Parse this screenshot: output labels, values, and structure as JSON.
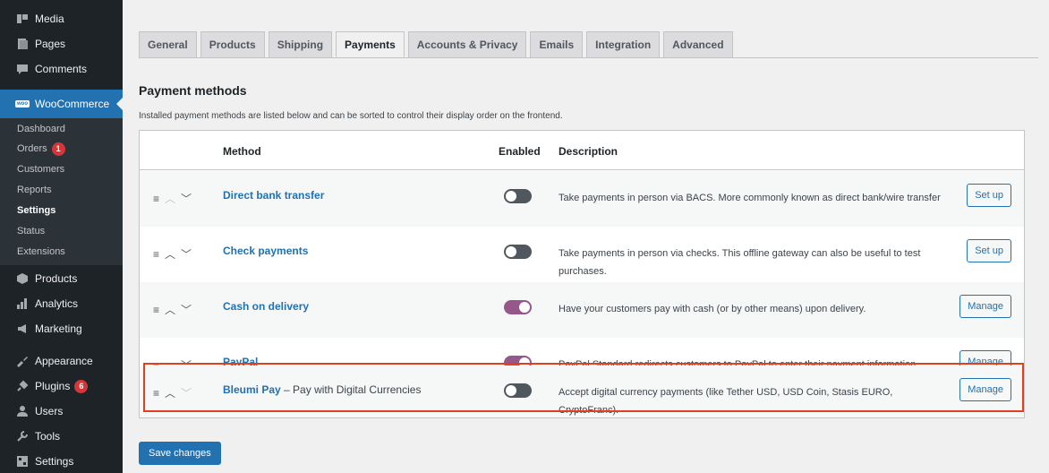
{
  "sidebar": {
    "top_items": [
      {
        "label": "Media",
        "icon": "media-icon"
      },
      {
        "label": "Pages",
        "icon": "pages-icon"
      },
      {
        "label": "Comments",
        "icon": "comments-icon"
      }
    ],
    "woocommerce": {
      "label": "WooCommerce",
      "icon": "woo-icon",
      "icon_text": "woo"
    },
    "submenu": [
      {
        "label": "Dashboard"
      },
      {
        "label": "Orders",
        "badge": "1"
      },
      {
        "label": "Customers"
      },
      {
        "label": "Reports"
      },
      {
        "label": "Settings",
        "current": true
      },
      {
        "label": "Status"
      },
      {
        "label": "Extensions"
      }
    ],
    "bottom_items": [
      {
        "label": "Products",
        "icon": "products-icon"
      },
      {
        "label": "Analytics",
        "icon": "analytics-icon"
      },
      {
        "label": "Marketing",
        "icon": "marketing-icon"
      },
      {
        "label": "Appearance",
        "icon": "appearance-icon"
      },
      {
        "label": "Plugins",
        "icon": "plugins-icon",
        "badge": "6"
      },
      {
        "label": "Users",
        "icon": "users-icon"
      },
      {
        "label": "Tools",
        "icon": "tools-icon"
      },
      {
        "label": "Settings",
        "icon": "settings-icon"
      }
    ]
  },
  "tabs": [
    {
      "label": "General"
    },
    {
      "label": "Products"
    },
    {
      "label": "Shipping"
    },
    {
      "label": "Payments",
      "active": true
    },
    {
      "label": "Accounts & Privacy"
    },
    {
      "label": "Emails"
    },
    {
      "label": "Integration"
    },
    {
      "label": "Advanced"
    }
  ],
  "section": {
    "title": "Payment methods",
    "description": "Installed payment methods are listed below and can be sorted to control their display order on the frontend."
  },
  "table": {
    "headers": {
      "method": "Method",
      "enabled": "Enabled",
      "description": "Description"
    },
    "rows": [
      {
        "name": "Direct bank transfer",
        "suffix": "",
        "enabled": false,
        "description": "Take payments in person via BACS. More commonly known as direct bank/wire transfer",
        "action": "Set up",
        "up_disabled": true
      },
      {
        "name": "Check payments",
        "suffix": "",
        "enabled": false,
        "description": "Take payments in person via checks. This offline gateway can also be useful to test purchases.",
        "action": "Set up",
        "up_disabled": false
      },
      {
        "name": "Cash on delivery",
        "suffix": "",
        "enabled": true,
        "description": "Have your customers pay with cash (or by other means) upon delivery.",
        "action": "Manage",
        "up_disabled": false
      },
      {
        "name": "PayPal",
        "suffix": "",
        "enabled": true,
        "description": "PayPal Standard redirects customers to PayPal to enter their payment information.",
        "action": "Manage",
        "up_disabled": false
      },
      {
        "name": "Bleumi Pay",
        "suffix": "– Pay with Digital Currencies",
        "enabled": false,
        "description": "Accept digital currency payments (like Tether USD, USD Coin, Stasis EURO, CryptoFranc).",
        "action": "Manage",
        "up_disabled": false
      }
    ]
  },
  "save_label": "Save changes",
  "colors": {
    "accent": "#2271b1",
    "toggle_on": "#96588a",
    "highlight": "#e2401c",
    "sidebar": "#1d2327"
  }
}
